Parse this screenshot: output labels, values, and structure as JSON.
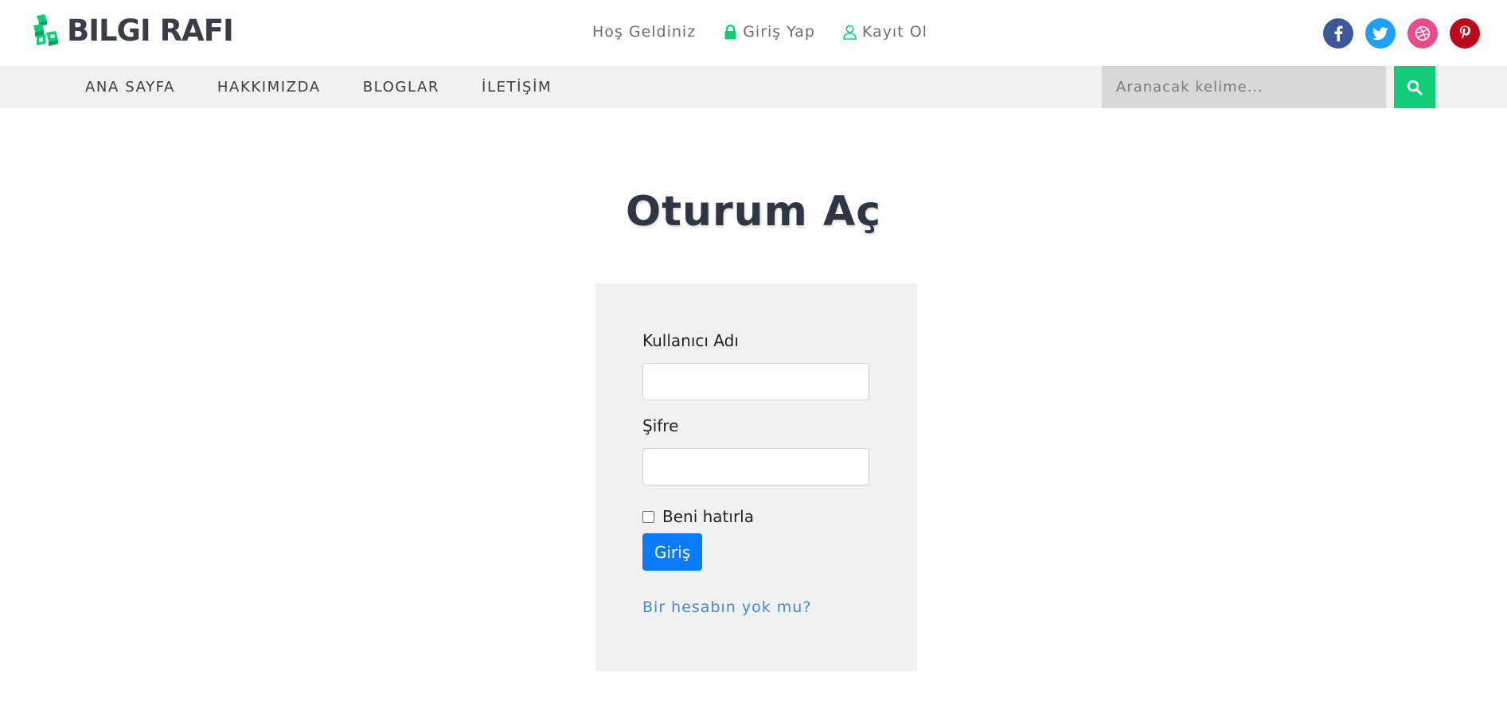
{
  "brand": {
    "name": "BILGI RAFI",
    "logo_icon": "stacked-boxes-icon",
    "accent_color": "#10cc76"
  },
  "top_links": {
    "welcome": "Hoş Geldiniz",
    "login": "Giriş Yap",
    "register": "Kayıt Ol"
  },
  "socials": [
    {
      "name": "facebook-icon",
      "color": "#3b5998"
    },
    {
      "name": "twitter-icon",
      "color": "#1da1f2"
    },
    {
      "name": "dribbble-icon",
      "color": "#ea4c89"
    },
    {
      "name": "pinterest-icon",
      "color": "#bd081c"
    }
  ],
  "nav": {
    "items": [
      "ANA SAYFA",
      "HAKKIMIZDA",
      "BLOGLAR",
      "İLETİŞİM"
    ]
  },
  "search": {
    "placeholder": "Aranacak kelime...",
    "value": "",
    "button_icon": "search-icon"
  },
  "main": {
    "title": "Oturum Aç",
    "form": {
      "username_label": "Kullanıcı Adı",
      "username_value": "",
      "password_label": "Şifre",
      "password_value": "",
      "remember_label": "Beni hatırla",
      "remember_checked": false,
      "submit_label": "Giriş",
      "submit_color": "#0a7bff",
      "register_link": "Bir hesabın yok mu?"
    }
  }
}
